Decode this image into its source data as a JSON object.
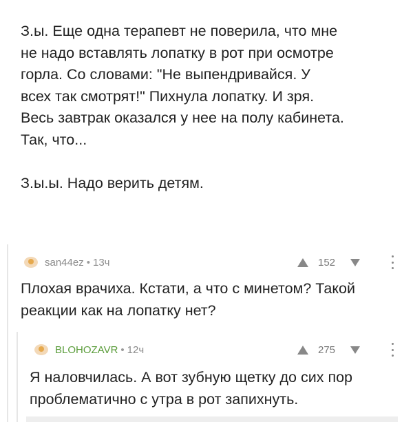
{
  "post": {
    "lines": [
      "З.ы. Еще одна терапевт не поверила, что мне",
      "не надо вставлять лопатку в рот при осмотре",
      "горла. Со словами: \"Не выпендривайся. У",
      "всех так смотрят!\" Пихнула лопатку. И зря.",
      "Весь завтрак оказался у нее на полу кабинета.",
      "Так, что...",
      "З.ы.ы. Надо верить детям."
    ]
  },
  "comments": [
    {
      "author": "san44ez",
      "separator": "•",
      "time": "13ч",
      "rating": "152",
      "lines": [
        "Плохая врачиха. Кстати, а что с минетом? Такой",
        "реакции как на лопатку нет?"
      ]
    },
    {
      "author": "BLOHOZAVR",
      "separator": "•",
      "time": "12ч",
      "rating": "275",
      "lines": [
        "Я наловчилась. А вот зубную щетку до сих пор",
        "проблематично с утра в рот запихнуть."
      ]
    }
  ]
}
